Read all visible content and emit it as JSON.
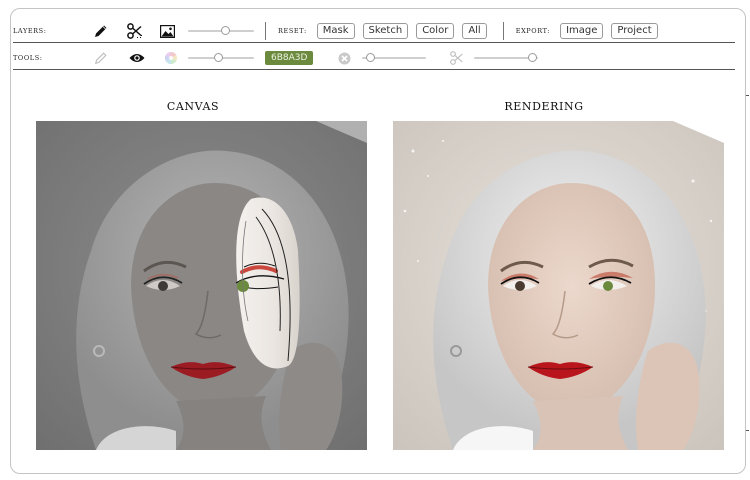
{
  "toolbar": {
    "layers": {
      "label": "LAYERS:",
      "icons": [
        "pencil-icon",
        "scissors-icon",
        "image-icon"
      ],
      "slider_value": 0.58
    },
    "reset": {
      "label": "RESET:",
      "buttons": [
        "Mask",
        "Sketch",
        "Color",
        "All"
      ]
    },
    "export": {
      "label": "EXPORT:",
      "buttons": [
        "Image",
        "Project"
      ]
    },
    "tools": {
      "label": "TOOLS:",
      "icons": [
        "pencil-icon",
        "eye-icon",
        "color-wheel-icon",
        "close-circle-icon",
        "scissors-icon"
      ],
      "brush_size_value": 0.45,
      "color_hex": "6B8A3D",
      "opacity_value": 0.07,
      "cut_size_value": 0.98
    }
  },
  "panels": {
    "canvas_title": "CANVAS",
    "rendering_title": "RENDERING"
  },
  "colors": {
    "accent": "#6B8A3D",
    "frame_border": "#c4c4c4",
    "lip_red": "#b8161c",
    "eyeshadow": "#c3604e"
  }
}
